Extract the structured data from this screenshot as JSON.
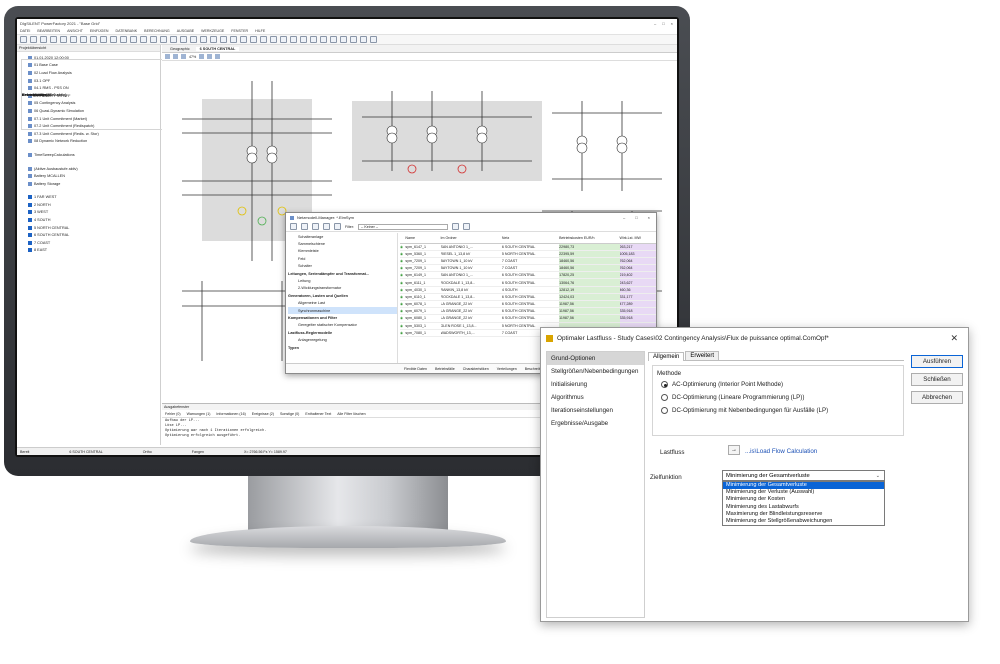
{
  "screen": {
    "title": "DIgSILENT PowerFactory 2021 - \"Base Grid\"",
    "menu": [
      "DATEI",
      "BEARBEITEN",
      "ANSICHT",
      "EINFÜGEN",
      "DATENBANK",
      "BERECHNUNG",
      "AUSGABE",
      "WERKZEUGE",
      "FENSTER",
      "HILFE"
    ],
    "project_panel_title": "Projektübersicht",
    "tree": {
      "calc_group": "Berechnungsfälle",
      "calc_items": [
        "01.01.2020 12:00:00",
        "01 Base Case",
        "02 Load Flow Analysis",
        "03.1 OPF",
        "04.1 RMS - PSS ON",
        "04.2 RMS - PSS OFF",
        "05 Contingency Analysis",
        "06 Quasi-Dynamic Simulation",
        "07.1 Unit Commitment (Market)",
        "07.2 Unit Commitment (Redispatch)",
        "07.3 Unit Commitment (Redis. w. Stor)",
        "08 Dynamic Network Reduction"
      ],
      "ops_group": "Betriebsfälle",
      "ops_items": [
        "TimeSweepCalculations"
      ],
      "variants_group": "Netzvarianten (0, 0 aktiv)",
      "variants_items": [
        "(Aktive Ausbaustufe aktiv)",
        "Battery MCALLEN",
        "Battery Storage"
      ],
      "nets_group": "Netze (8 aktiv)",
      "nets_items": [
        "1 FAR WEST",
        "2 NORTH",
        "3 WEST",
        "4 SOUTH",
        "5 NORTH CENTRAL",
        "6 SOUTH CENTRAL",
        "7 COAST",
        "8 EAST"
      ]
    },
    "tabs": [
      "Geographic",
      "6 SOUTH CENTRAL"
    ],
    "zoom": "47%",
    "output": {
      "title": "Ausgabefenster",
      "filters": [
        "Fehler (0)",
        "Warnungen (1)",
        "Informationen (16)",
        "Ereignisse (2)",
        "Sonstige (0)",
        "Enthaltener Text",
        "Alle Filter löschen"
      ],
      "lines": [
        "Aufbau der LP...",
        "Löse LP...",
        "Optimierung war nach 1 Iterationen erfolgreich.",
        "Optimierung erfolgreich ausgeführt."
      ]
    },
    "status": [
      "Bereit",
      "6 SOUTH CENTRAL",
      "Ortho",
      "Fangen",
      "X= 2766.56 Fs   Y= 1589.97"
    ],
    "network_manager": {
      "title": "Netzmodell-Manager: *.ElmSym",
      "filter_label": "Filter:",
      "filter_value": "-- Keiner --",
      "tree": [
        {
          "label": "Schalteranlage",
          "cls": "it"
        },
        {
          "label": "Sammelschiene",
          "cls": "it"
        },
        {
          "label": "Klemmleiste",
          "cls": "it"
        },
        {
          "label": "Feld",
          "cls": "it"
        },
        {
          "label": "Schalter",
          "cls": "it"
        },
        {
          "label": "Leitungen, Seriendämpfer und Transformat...",
          "cls": "cat"
        },
        {
          "label": "Leitung",
          "cls": "it"
        },
        {
          "label": "2-Wicklungstransformator",
          "cls": "it"
        },
        {
          "label": "Generatoren, Lasten und Quellen",
          "cls": "cat"
        },
        {
          "label": "Allgemeine Last",
          "cls": "it"
        },
        {
          "label": "Synchronmaschine",
          "cls": "it sel"
        },
        {
          "label": "Kompensationen und Filter",
          "cls": "cat"
        },
        {
          "label": "Geregelter statischer Kompensator",
          "cls": "it"
        },
        {
          "label": "Lastfluss-Reglermodelle",
          "cls": "cat"
        },
        {
          "label": "Anlagenregelung",
          "cls": "it"
        },
        {
          "label": "Typen",
          "cls": "cat"
        }
      ],
      "columns": [
        "Name",
        "Im Ordner",
        "Netz",
        "Betriebskosten EUR/h",
        "Wirk.Lst. MW"
      ],
      "rows": [
        [
          "sym_6147_1",
          "SAN ANTONIO 1_...",
          "6 SOUTH CENTRAL",
          "22980,73",
          "263,217"
        ],
        [
          "sym_5360_1",
          "RIESEL 1_13,8 kV",
          "5 NORTH CENTRAL",
          "22395,59",
          "1005,183"
        ],
        [
          "sym_7209_1",
          "BAYTOWN 1_10 kV",
          "7 COAST",
          "18460,56",
          "762,064"
        ],
        [
          "sym_7209_1",
          "BAYTOWN 1_10 kV",
          "7 COAST",
          "18460,56",
          "762,064"
        ],
        [
          "sym_6149_1",
          "SAN ANTONIO 1_...",
          "6 SOUTH CENTRAL",
          "17820,25",
          "219,402"
        ],
        [
          "sym_6111_1",
          "ROCKDALE 1_13,8...",
          "6 SOUTH CENTRAL",
          "13064,76",
          "243,627"
        ],
        [
          "sym_4030_1",
          "RANKIN_13,8 kV",
          "4 SOUTH",
          "12812,19",
          "460,36"
        ],
        [
          "sym_6110_1",
          "ROCKDALE 1_13,8...",
          "6 SOUTH CENTRAL",
          "12424,03",
          "331,177"
        ],
        [
          "sym_6078_1",
          "LA GRANGE_22 kV",
          "6 SOUTH CENTRAL",
          "11987,56",
          "477,289"
        ],
        [
          "sym_6079_1",
          "LA GRANGE_22 kV",
          "6 SOUTH CENTRAL",
          "11987,56",
          "335,918"
        ],
        [
          "sym_6080_1",
          "LA GRANGE_22 kV",
          "6 SOUTH CENTRAL",
          "11987,56",
          "335,918"
        ],
        [
          "sym_5303_1",
          "GLEN ROSE 1_13,8...",
          "5 NORTH CENTRAL",
          "",
          ""
        ],
        [
          "sym_7080_1",
          "WADSWORTH_13,...",
          "7 COAST",
          "",
          ""
        ]
      ],
      "bottom_tabs": [
        "Flexible Daten",
        "Betriebsfälle",
        "Charakteristiken",
        "Verteilungen",
        "Beschreibung"
      ],
      "row_info": "Ln 313",
      "count": "344 Objekt(e) von 344"
    }
  },
  "dialog": {
    "title": "Optimaler Lastfluss - Study Cases\\02 Contingency Analysis\\Flux de puissance optimal.ComOpf*",
    "nav": [
      "Grund-Optionen",
      "Stellgrößen/Nebenbedingungen",
      "Initialisierung",
      "Algorithmus",
      "Iterationseinstellungen",
      "Ergebnisse/Ausgabe"
    ],
    "tabs": [
      "Allgemein",
      "Erweitert"
    ],
    "method_label": "Methode",
    "methods": [
      "AC-Optimierung (Interior Point Methode)",
      "DC-Optimierung (Lineare Programmierung (LP))",
      "DC-Optimierung mit Nebenbedingungen für Ausfälle (LP)"
    ],
    "loadflow_label": "Lastfluss",
    "loadflow_button": "→",
    "loadflow_link": "...is\\Load Flow Calculation",
    "objective_label": "Zielfunktion",
    "objective_value": "Minimierung der Gesamtverluste",
    "objective_options": [
      "Minimierung der Gesamtverluste",
      "Minimierung der Verluste (Auswahl)",
      "Minimierung der Kosten",
      "Minimierung des Lastabwurfs",
      "Maximierung der Blindleistungsreserve",
      "Minimierung der Stellgrößenabweichungen"
    ],
    "buttons": [
      "Ausführen",
      "Schließen",
      "Abbrechen"
    ],
    "close_glyph": "✕"
  }
}
